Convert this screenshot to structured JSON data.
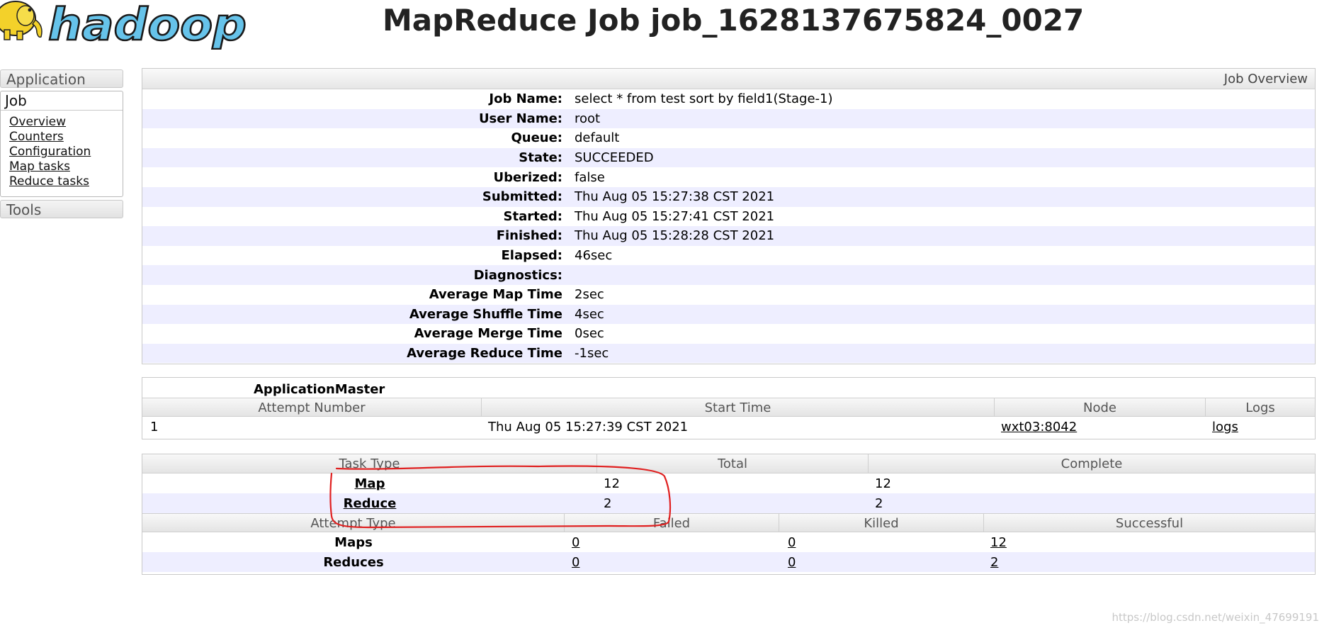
{
  "header": {
    "logo_text": "hadoop",
    "title": "MapReduce Job job_1628137675824_0027"
  },
  "sidebar": {
    "application_label": "Application",
    "job_label": "Job",
    "job_links": [
      "Overview",
      "Counters",
      "Configuration",
      "Map tasks",
      "Reduce tasks"
    ],
    "tools_label": "Tools"
  },
  "overview": {
    "heading": "Job Overview",
    "rows": [
      {
        "label": "Job Name:",
        "value": "select * from test sort by field1(Stage-1)"
      },
      {
        "label": "User Name:",
        "value": "root"
      },
      {
        "label": "Queue:",
        "value": "default"
      },
      {
        "label": "State:",
        "value": "SUCCEEDED"
      },
      {
        "label": "Uberized:",
        "value": "false"
      },
      {
        "label": "Submitted:",
        "value": "Thu Aug 05 15:27:38 CST 2021"
      },
      {
        "label": "Started:",
        "value": "Thu Aug 05 15:27:41 CST 2021"
      },
      {
        "label": "Finished:",
        "value": "Thu Aug 05 15:28:28 CST 2021"
      },
      {
        "label": "Elapsed:",
        "value": "46sec"
      },
      {
        "label": "Diagnostics:",
        "value": ""
      },
      {
        "label": "Average Map Time",
        "value": "2sec"
      },
      {
        "label": "Average Shuffle Time",
        "value": "4sec"
      },
      {
        "label": "Average Merge Time",
        "value": "0sec"
      },
      {
        "label": "Average Reduce Time",
        "value": "-1sec"
      }
    ]
  },
  "application_master": {
    "caption": "ApplicationMaster",
    "columns": [
      "Attempt Number",
      "Start Time",
      "Node",
      "Logs"
    ],
    "row": {
      "attempt": "1",
      "start_time": "Thu Aug 05 15:27:39 CST 2021",
      "node": "wxt03:8042",
      "logs": "logs"
    }
  },
  "tasks": {
    "columns": [
      "Task Type",
      "Total",
      "Complete"
    ],
    "rows": [
      {
        "type": "Map",
        "total": "12",
        "complete": "12"
      },
      {
        "type": "Reduce",
        "total": "2",
        "complete": "2"
      }
    ]
  },
  "attempts": {
    "columns": [
      "Attempt Type",
      "Failed",
      "Killed",
      "Successful"
    ],
    "rows": [
      {
        "type": "Maps",
        "failed": "0",
        "killed": "0",
        "successful": "12"
      },
      {
        "type": "Reduces",
        "failed": "0",
        "killed": "0",
        "successful": "2"
      }
    ]
  },
  "watermark": "https://blog.csdn.net/weixin_47699191",
  "colors": {
    "accent_row": "#eeeeff",
    "annotation_stroke": "#e02020",
    "logo_fill": "#66c3ea"
  }
}
